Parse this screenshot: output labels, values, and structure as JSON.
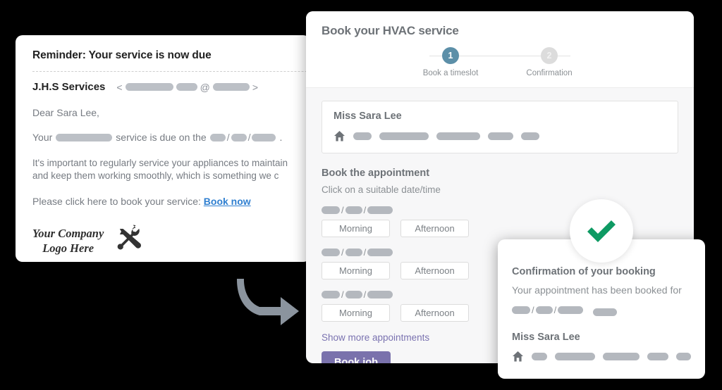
{
  "email": {
    "subject": "Reminder: Your service is now due",
    "sender": "J.H.S Services",
    "address_open": "<",
    "address_close": ">",
    "at_symbol": "@",
    "greeting": "Dear Sara Lee,",
    "due_prefix": "Your",
    "due_middle": "service is due on the",
    "due_suffix": ".",
    "body": "It's important to regularly service your appliances to maintain\nand keep them working smoothly, which is something we c",
    "cta_text": "Please click here to book your service:",
    "cta_link": "Book now",
    "logo_text": "Your Company\nLogo Here",
    "logo_icon": "wrench-screwdriver-icon",
    "redactions": {
      "email_user": 68,
      "email_user2": 30,
      "email_domain": 52,
      "service_type": 80,
      "date_dd": 22,
      "date_mm": 22,
      "date_yyyy": 34
    }
  },
  "booking": {
    "title": "Book your HVAC service",
    "steps": [
      {
        "number": "1",
        "label": "Book a timeslot",
        "state": "active"
      },
      {
        "number": "2",
        "label": "Confirmation",
        "state": "inactive"
      }
    ],
    "customer": {
      "name": "Miss Sara Lee",
      "home_icon": "home-icon",
      "address_pills": [
        26,
        70,
        62,
        36,
        26
      ]
    },
    "section_title": "Book the appointment",
    "section_subtitle": "Click on a suitable date/time",
    "slots": [
      {
        "date_pills": [
          26,
          24,
          36
        ],
        "morning": "Morning",
        "afternoon": "Afternoon"
      },
      {
        "date_pills": [
          26,
          24,
          36
        ],
        "morning": "Morning",
        "afternoon": "Afternoon"
      },
      {
        "date_pills": [
          26,
          24,
          36
        ],
        "morning": "Morning",
        "afternoon": "Afternoon"
      }
    ],
    "show_more": "Show more appointments",
    "book_job": "Book job",
    "colors": {
      "step_active": "#5c8fa8",
      "step_inactive": "#dcdcdc",
      "primary_button": "#7a72ac",
      "link": "#7a72b0"
    }
  },
  "confirmation": {
    "badge_icon": "green-checkmark-icon",
    "badge_color": "#0e9a63",
    "title": "Confirmation of your booking",
    "text": "Your appointment has been booked for",
    "datetime_pills": {
      "date": [
        26,
        24,
        36
      ],
      "time": [
        34
      ]
    },
    "name": "Miss Sara Lee",
    "home_icon": "home-icon",
    "address_pills": [
      26,
      70,
      62,
      36,
      26
    ]
  },
  "flow": {
    "arrow_icon": "curved-arrow-right-icon",
    "arrow_color": "#8b949e"
  }
}
